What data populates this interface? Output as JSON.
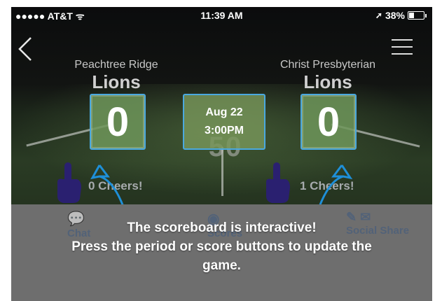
{
  "status_bar": {
    "carrier": "●●●●● AT&T ᯤ",
    "time": "11:39 AM",
    "battery_text": "38%"
  },
  "nav": {
    "back_icon": "chevron-left-icon",
    "menu_icon": "hamburger-menu-icon"
  },
  "home_team": {
    "school": "Peachtree Ridge",
    "name": "Lions",
    "score": "0",
    "cheers": "0 Cheers!"
  },
  "away_team": {
    "school": "Christ Presbyterian",
    "name": "Lions",
    "score": "0",
    "cheers": "1 Cheers!"
  },
  "game_info": {
    "date": "Aug 22",
    "time": "3:00PM"
  },
  "field": {
    "yard_marker": "50"
  },
  "bottom_tabs": [
    {
      "label": "Chat"
    },
    {
      "label": "Scores"
    },
    {
      "label": "Social Share"
    }
  ],
  "tooltip": {
    "line1": "The scoreboard is interactive!",
    "line2": "Press the period or score buttons to update the",
    "line3": "game."
  },
  "colors": {
    "accent": "#4aa9e0",
    "overlay": "#6e6e6e",
    "foam_finger": "#2a2070"
  }
}
